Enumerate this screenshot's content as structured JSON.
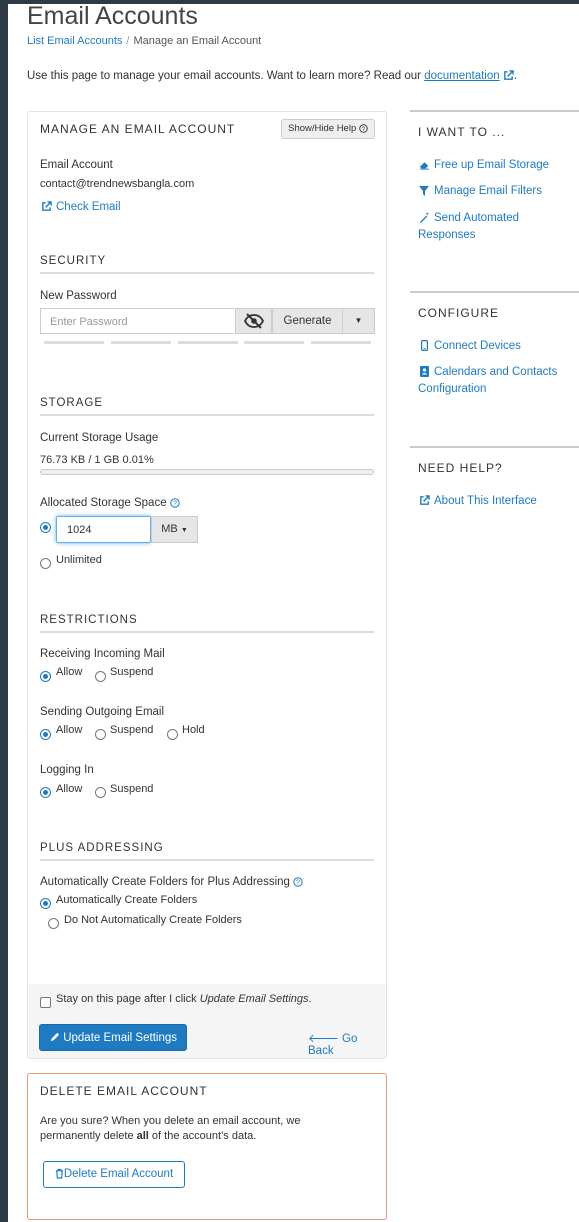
{
  "page": {
    "title": "Email Accounts",
    "breadcrumb": [
      "List Email Accounts",
      "Manage an Email Account"
    ],
    "intro_text": "Use this page to manage your email accounts. Want to learn more? Read our",
    "intro_link": "documentation",
    "intro_end": "."
  },
  "manage": {
    "title": "MANAGE AN EMAIL ACCOUNT",
    "help_button": "Show/Hide Help",
    "account_label": "Email Account",
    "account_value": "contact@trendnewsbangla.com",
    "check_email": "Check Email"
  },
  "security": {
    "heading": "SECURITY",
    "new_password_label": "New Password",
    "password_placeholder": "Enter Password",
    "generate": "Generate"
  },
  "storage": {
    "heading": "STORAGE",
    "usage_label": "Current Storage Usage",
    "usage_value": "76.73 KB / 1 GB 0.01%",
    "usage_fraction": 0.0001,
    "allocated_label": "Allocated Storage Space",
    "size_value": "1024",
    "unit": "MB",
    "unlimited": "Unlimited"
  },
  "restrictions": {
    "heading": "RESTRICTIONS",
    "incoming_label": "Receiving Incoming Mail",
    "outgoing_label": "Sending Outgoing Email",
    "login_label": "Logging In",
    "allow": "Allow",
    "suspend": "Suspend",
    "hold": "Hold"
  },
  "plus": {
    "heading": "PLUS ADDRESSING",
    "label": "Automatically Create Folders for Plus Addressing",
    "auto": "Automatically Create Folders",
    "no_auto": "Do Not Automatically Create Folders"
  },
  "footer": {
    "stay_text": "Stay on this page after I click",
    "stay_em": "Update Email Settings",
    "stay_end": ".",
    "update_button": "Update Email Settings",
    "go_back": "Go Back"
  },
  "delete": {
    "title": "DELETE EMAIL ACCOUNT",
    "warning_1": "Are you sure? When you delete an email account, we",
    "warning_2a": "permanently delete",
    "warning_bold": "all",
    "warning_2b": "of the account’s data.",
    "button": "Delete Email Account"
  },
  "sidebar": {
    "i_want_to": "I WANT TO ...",
    "want_links": [
      "Free up Email Storage",
      "Manage Email Filters",
      "Send Automated Responses"
    ],
    "configure": "CONFIGURE",
    "config_links": [
      "Connect Devices",
      "Calendars and Contacts Configuration"
    ],
    "need_help": "NEED HELP?",
    "help_links": [
      "About This Interface"
    ]
  },
  "colors": {
    "accent": "#1f7bc1",
    "danger_border": "#e89b6e"
  }
}
